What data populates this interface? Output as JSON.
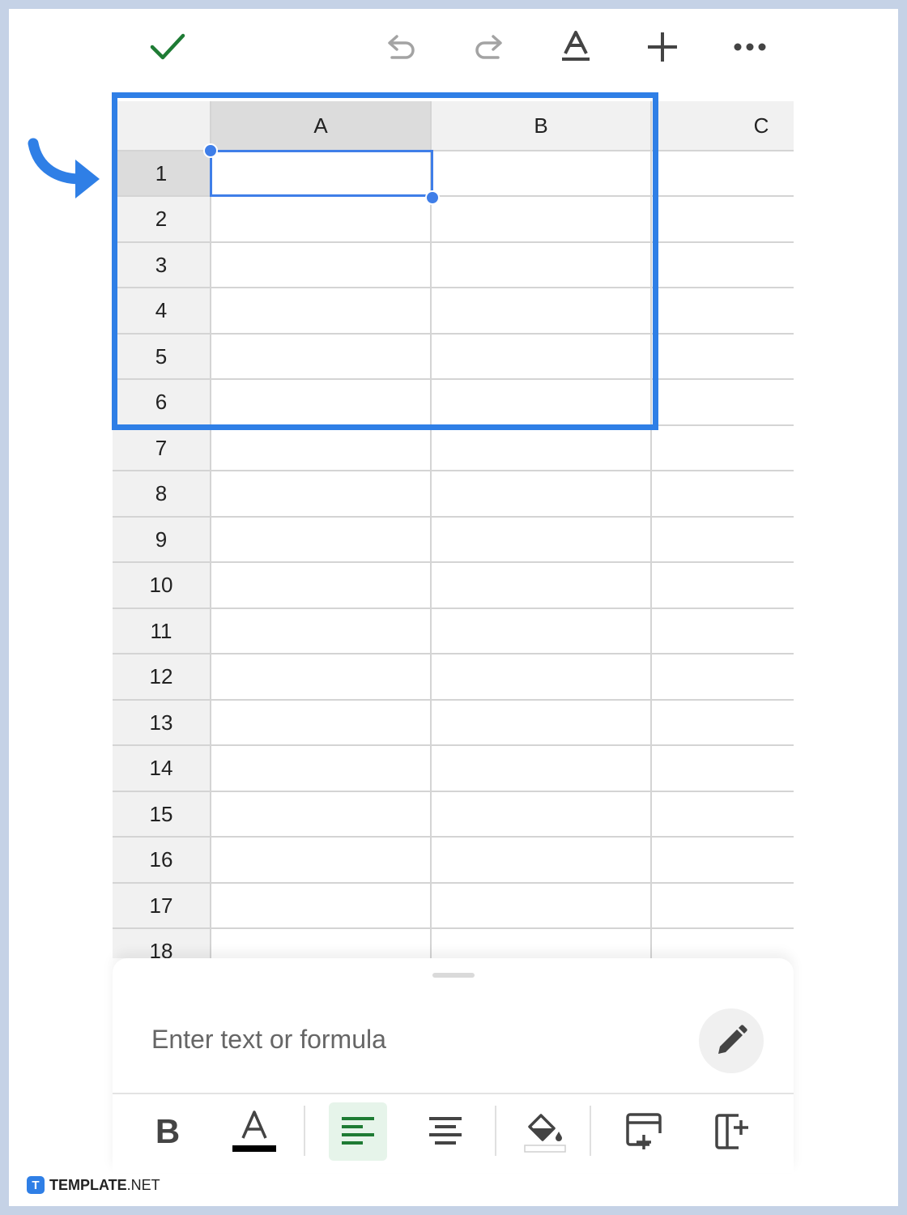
{
  "toolbar": {
    "done": "check-icon",
    "undo": "undo-icon",
    "redo": "redo-icon",
    "text_format": "text-format-icon",
    "insert": "plus-icon",
    "more": "more-horizontal-icon"
  },
  "grid": {
    "columns": [
      "A",
      "B",
      "C"
    ],
    "rows": [
      "1",
      "2",
      "3",
      "4",
      "5",
      "6",
      "7",
      "8",
      "9",
      "10",
      "11",
      "12",
      "13",
      "14",
      "15",
      "16",
      "17",
      "18"
    ],
    "selected_cell": "A1"
  },
  "sheet": {
    "placeholder": "Enter text or formula",
    "value": ""
  },
  "format_bar": {
    "bold_label": "B",
    "text_color_label": "A",
    "active_tool": "align-left"
  },
  "colors": {
    "accent": "#2f7fe6",
    "check": "#1e7b34",
    "active_format_bg": "#e6f4ea"
  },
  "branding": {
    "prefix": "TEMPLATE",
    "suffix": ".NET",
    "logo_letter": "T"
  }
}
